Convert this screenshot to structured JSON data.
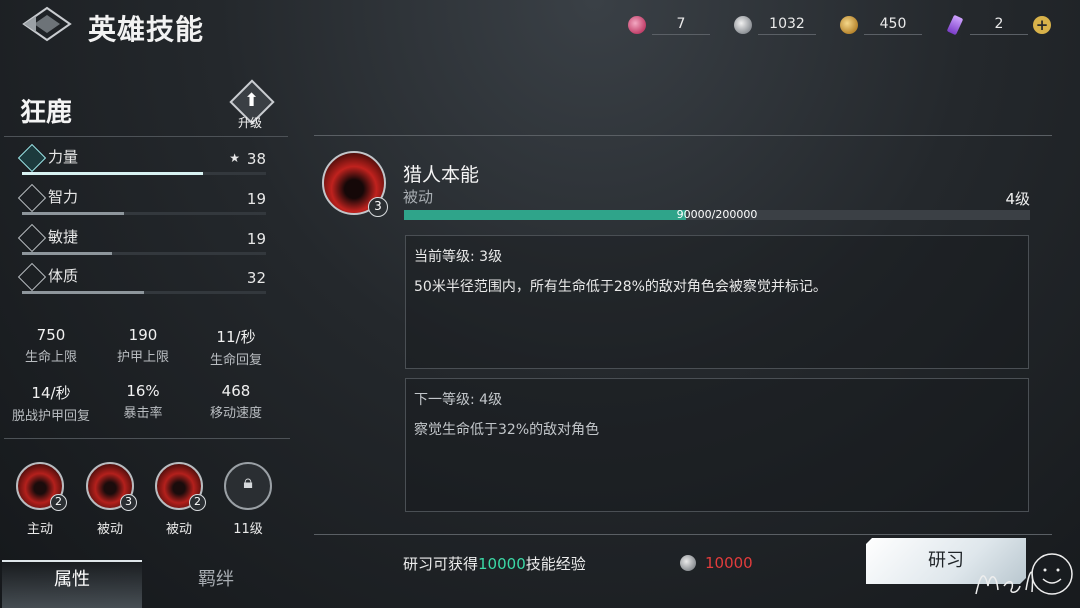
{
  "header": {
    "title": "英雄技能",
    "currencies": [
      {
        "icon": "pink-gem-icon",
        "value": "7",
        "color": "#d46a8c"
      },
      {
        "icon": "silver-coin-icon",
        "value": "1032",
        "color": "#b8bcc0"
      },
      {
        "icon": "gold-coin-icon",
        "value": "450",
        "color": "#d9ac4a"
      },
      {
        "icon": "purple-crystal-icon",
        "value": "2",
        "color": "#a064e0"
      }
    ],
    "plus_label": "+"
  },
  "hero": {
    "name": "狂鹿",
    "upgrade_label": "升级",
    "stats": [
      {
        "name": "力量",
        "value": "38",
        "star": "★",
        "fill": 0.74,
        "active": true
      },
      {
        "name": "智力",
        "value": "19",
        "fill": 0.42
      },
      {
        "name": "敏捷",
        "value": "19",
        "fill": 0.37
      },
      {
        "name": "体质",
        "value": "32",
        "fill": 0.5
      }
    ],
    "derived": [
      {
        "value": "750",
        "label": "生命上限"
      },
      {
        "value": "190",
        "label": "护甲上限"
      },
      {
        "value": "11/秒",
        "label": "生命回复"
      },
      {
        "value": "14/秒",
        "label": "脱战护甲回复"
      },
      {
        "value": "16%",
        "label": "暴击率"
      },
      {
        "value": "468",
        "label": "移动速度"
      }
    ],
    "skills": [
      {
        "label": "主动",
        "level": "2"
      },
      {
        "label": "被动",
        "level": "3"
      },
      {
        "label": "被动",
        "level": "2"
      },
      {
        "label": "11级",
        "level": ""
      }
    ]
  },
  "tabs": {
    "attributes": "属性",
    "bonds": "羁绊"
  },
  "skill_detail": {
    "title": "猎人本能",
    "type": "被动",
    "badge": "3",
    "next_level": "4级",
    "xp_text": "90000/200000",
    "xp_fraction": 0.45,
    "current": {
      "head": "当前等级: 3级",
      "body": "50米半径范围内，所有生命低于28%的敌对角色会被察觉并标记。"
    },
    "next": {
      "head": "下一等级: 4级",
      "body": "察觉生命低于32%的敌对角色"
    }
  },
  "research": {
    "prefix": "研习可获得",
    "amount": "10000",
    "suffix": "技能经验",
    "cost": "10000",
    "button_label": "研习"
  },
  "colors": {
    "accent": "#2fa48a",
    "cost_red": "#e23c3c",
    "highlight_green": "#3bd9a6"
  }
}
